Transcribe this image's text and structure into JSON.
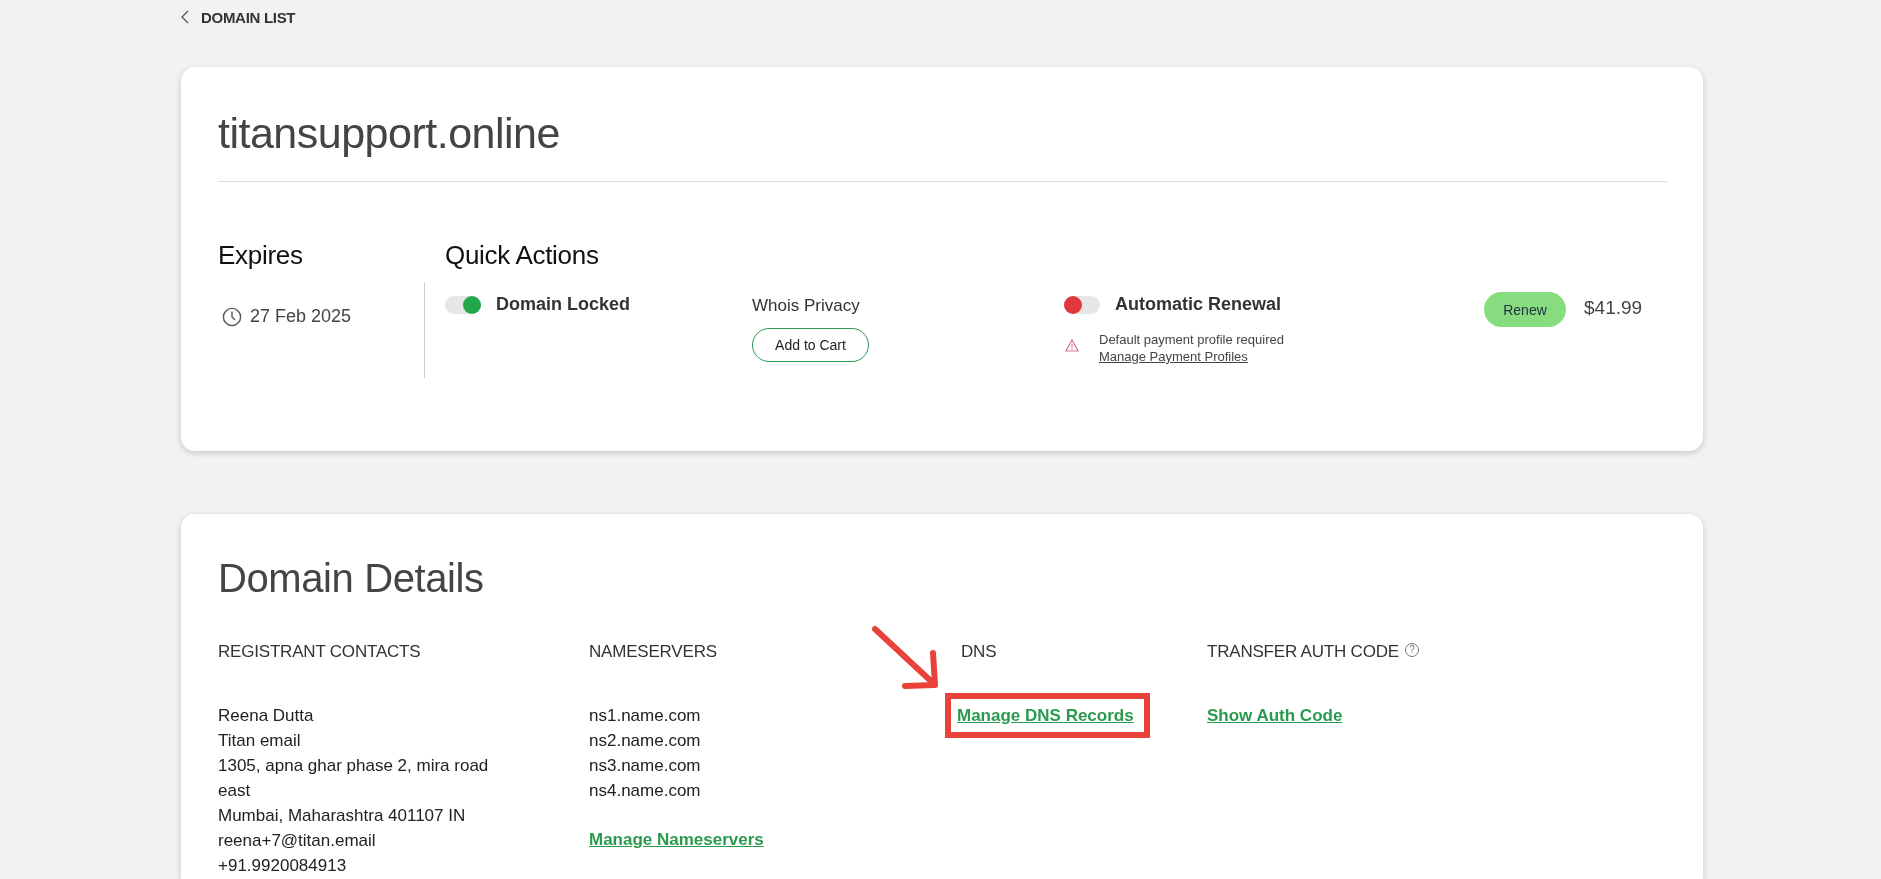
{
  "back_link": {
    "label": "DOMAIN LIST"
  },
  "domain": {
    "name": "titansupport.online"
  },
  "expires": {
    "heading": "Expires",
    "date": "27 Feb 2025"
  },
  "quick_actions": {
    "heading": "Quick Actions",
    "items": [
      {
        "kind": "toggle",
        "label": "Domain Locked",
        "on": true
      },
      {
        "kind": "purchase",
        "label": "Whois Privacy",
        "button": "Add to Cart"
      },
      {
        "kind": "toggle",
        "label": "Automatic Renewal",
        "on": false,
        "warning": {
          "text": "Default payment profile required",
          "link": "Manage Payment Profiles"
        }
      }
    ]
  },
  "renewal": {
    "button": "Renew",
    "price": "$41.99"
  },
  "details": {
    "heading": "Domain Details",
    "columns": [
      {
        "heading": "REGISTRANT CONTACTS",
        "lines": [
          "Reena Dutta",
          "Titan email",
          "1305, apna ghar phase 2, mira road east",
          "Mumbai, Maharashtra 401107 IN",
          "reena+7@titan.email",
          "+91.9920084913"
        ]
      },
      {
        "heading": "NAMESERVERS",
        "lines": [
          "ns1.name.com",
          "ns2.name.com",
          "ns3.name.com",
          "ns4.name.com"
        ],
        "link": "Manage Nameservers"
      },
      {
        "heading": "DNS",
        "link": "Manage DNS Records",
        "highlighted": true
      },
      {
        "heading": "TRANSFER AUTH CODE",
        "help": "?",
        "link": "Show Auth Code"
      }
    ]
  }
}
